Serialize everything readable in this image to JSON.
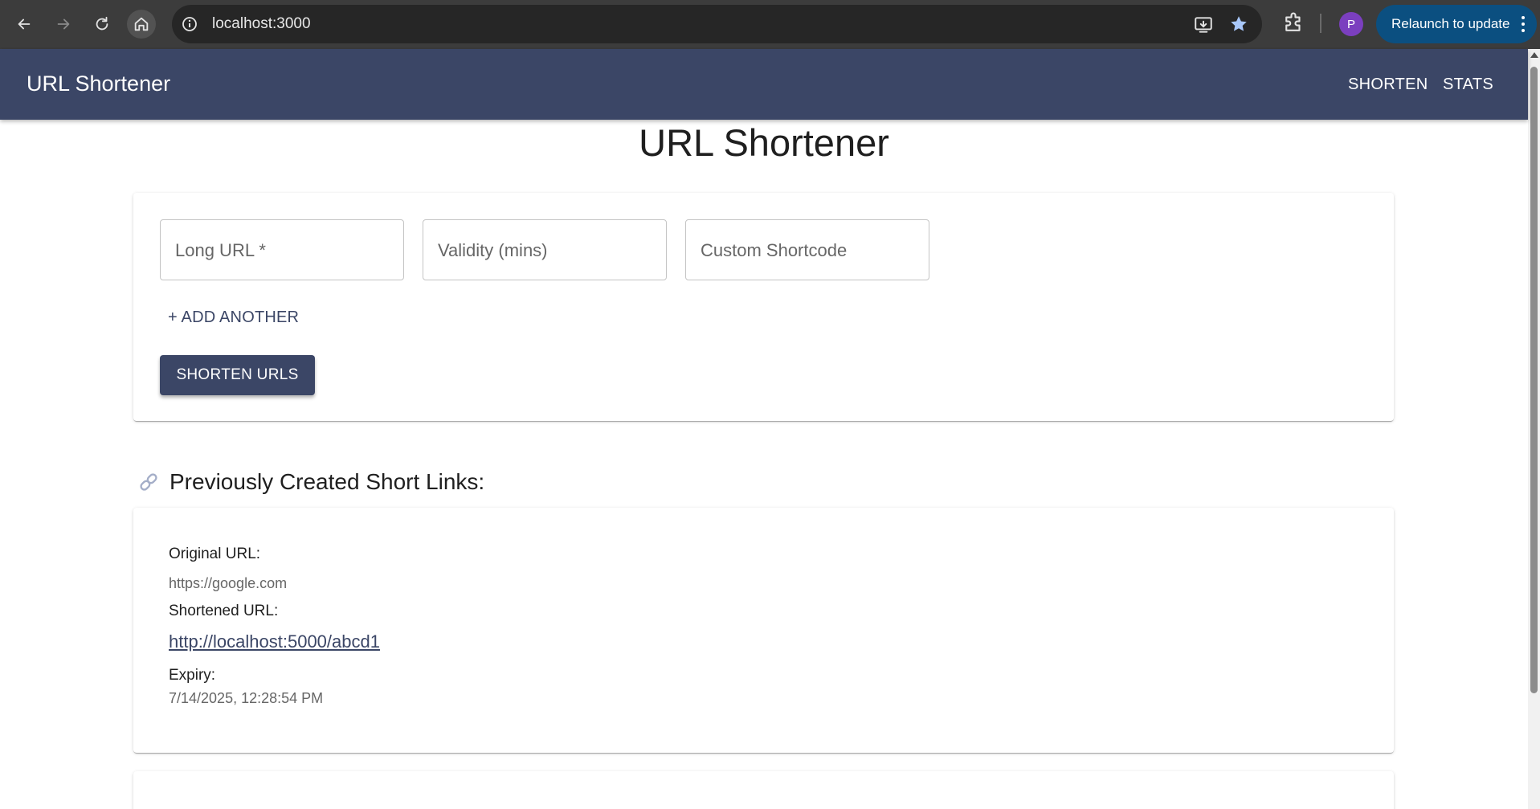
{
  "browser": {
    "url": "localhost:3000",
    "profile_initial": "P",
    "relaunch_label": "Relaunch to update"
  },
  "appbar": {
    "brand": "URL Shortener",
    "nav": [
      "SHORTEN",
      "STATS"
    ]
  },
  "main": {
    "title": "URL Shortener",
    "form": {
      "fields": [
        {
          "placeholder": "Long URL *",
          "value": ""
        },
        {
          "placeholder": "Validity (mins)",
          "value": ""
        },
        {
          "placeholder": "Custom Shortcode",
          "value": ""
        }
      ],
      "add_another_label": "+ ADD ANOTHER",
      "submit_label": "SHORTEN URLS"
    },
    "history": {
      "heading": "Previously Created Short Links:",
      "items": [
        {
          "original_label": "Original URL:",
          "original_url": "https://google.com",
          "short_label": "Shortened URL:",
          "short_url": "http://localhost:5000/abcd1",
          "expiry_label": "Expiry:",
          "expiry": "7/14/2025, 12:28:54 PM"
        }
      ]
    }
  },
  "colors": {
    "appbar": "#3b4666",
    "primary_button": "#3b4666",
    "relaunch": "#0b4f80"
  },
  "icons": {
    "back": "arrow-left-icon",
    "forward": "arrow-right-icon",
    "reload": "reload-icon",
    "home": "home-icon",
    "site_info": "info-icon",
    "install": "install-app-icon",
    "bookmark": "star-icon",
    "extensions": "puzzle-icon",
    "menu": "kebab-menu-icon",
    "section": "link-icon"
  }
}
